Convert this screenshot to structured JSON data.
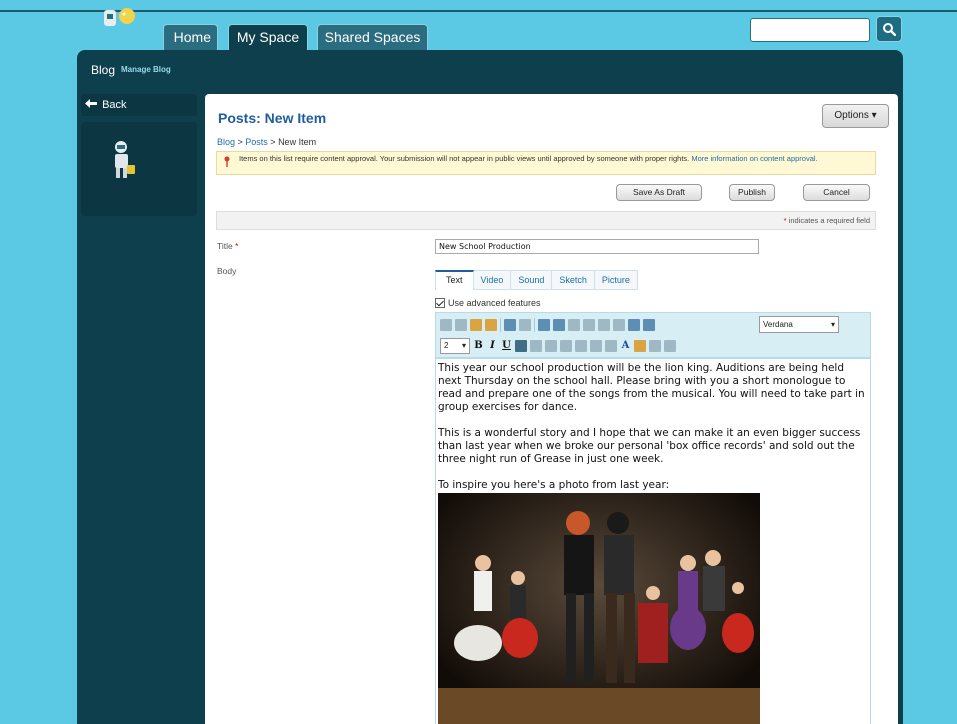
{
  "nav": {
    "tabs": [
      {
        "label": "Home"
      },
      {
        "label": "My Space"
      },
      {
        "label": "Shared Spaces"
      }
    ]
  },
  "site": {
    "title": "Blog",
    "manage_link": "Manage Blog"
  },
  "sidebar": {
    "back_label": "Back"
  },
  "page": {
    "title": "Posts: New Item",
    "options_label": "Options",
    "breadcrumb": {
      "blog": "Blog",
      "sep1": " > ",
      "posts": "Posts",
      "sep2": " > ",
      "current": "New Item"
    },
    "notice": {
      "text": "Items on this list require content approval. Your submission will not appear in public views until approved by someone with proper rights. ",
      "link": "More information on content approval."
    },
    "buttons": {
      "save_draft": "Save As Draft",
      "publish": "Publish",
      "cancel": "Cancel"
    },
    "required_note": "indicates a required field"
  },
  "form": {
    "title_label": "Title",
    "title_value": "New School Production",
    "body_label": "Body",
    "media_tabs": [
      "Text",
      "Video",
      "Sound",
      "Sketch",
      "Picture"
    ],
    "advanced_label": "Use advanced features",
    "font_name": "Verdana",
    "font_size": "2"
  },
  "editor": {
    "paragraphs": [
      "This year our school production will be the lion king. Auditions are being held next Thursday on the school hall. Please bring with you a short monologue to read and prepare one of the songs from the musical. You will need to take part in group exercises for dance.",
      "This is a wonderful story and I hope that we can make it an even bigger success than last year when we broke our personal 'box office records' and sold out the three night run of Grease in just one week.",
      "To inspire you here's a photo from last year:"
    ]
  }
}
